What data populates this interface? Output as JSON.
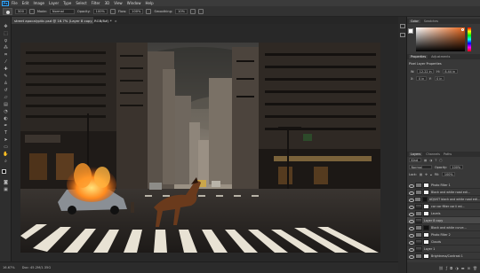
{
  "menubar": {
    "logo": "Ps",
    "items": [
      "File",
      "Edit",
      "Image",
      "Layer",
      "Type",
      "Select",
      "Filter",
      "3D",
      "View",
      "Window",
      "Help"
    ]
  },
  "options": {
    "brush_size": "500",
    "mode_label": "Mode:",
    "mode_value": "Normal",
    "opacity_label": "Opacity:",
    "opacity_value": "100%",
    "flow_label": "Flow:",
    "flow_value": "100%",
    "smoothing_label": "Smoothing:",
    "smoothing_value": "10%"
  },
  "document": {
    "tab_title": "street apocalyptic.psd @ 16.7% (Layer 8 copy, RGB/8#) *",
    "close": "×"
  },
  "statusbar": {
    "zoom": "16.67%",
    "doc_size": "Doc: 45.2M/1.35G"
  },
  "panels": {
    "color_tabs": [
      "Color",
      "Swatches"
    ],
    "properties_tabs": [
      "Properties",
      "Adjustments"
    ],
    "properties_title": "Pixel Layer Properties",
    "w_label": "W:",
    "w_value": "12.22 in",
    "h_label": "H:",
    "h_value": "8.44 in",
    "x_label": "X:",
    "x_value": "0 in",
    "y_label": "Y:",
    "y_value": "0 in",
    "layers_tabs": [
      "Layers",
      "Channels",
      "Paths"
    ],
    "kind_label": "Kind",
    "blend_mode": "Normal",
    "opacity_label": "Opacity:",
    "opacity_value": "100%",
    "lock_label": "Lock:",
    "fill_label": "Fill:",
    "fill_value": "100%"
  },
  "layers": [
    {
      "name": "Photo Filter 1",
      "type": "adjust",
      "mask": "light"
    },
    {
      "name": "Black and white road edi...",
      "type": "adjust",
      "mask": "light"
    },
    {
      "name": "ADJUST black and white road edi...",
      "type": "adjust",
      "mask": "dark"
    },
    {
      "name": "car car filter car ii ed...",
      "type": "image",
      "mask": "light"
    },
    {
      "name": "Levels",
      "type": "adjust",
      "mask": "light"
    },
    {
      "name": "Layer 8 copy",
      "type": "image",
      "mask": "none"
    },
    {
      "name": "Black and white curve...",
      "type": "adjust",
      "mask": "dark"
    },
    {
      "name": "Photo Filter 2",
      "type": "adjust",
      "mask": "light"
    },
    {
      "name": "Clouds",
      "type": "image",
      "mask": "light"
    },
    {
      "name": "Layer 1",
      "type": "image",
      "mask": "none"
    },
    {
      "name": "Brightness/Contrast 1",
      "type": "adjust",
      "mask": "light"
    }
  ],
  "colors": {
    "accent": "#31a8ff",
    "color_picker_hue": "#e8661b"
  }
}
